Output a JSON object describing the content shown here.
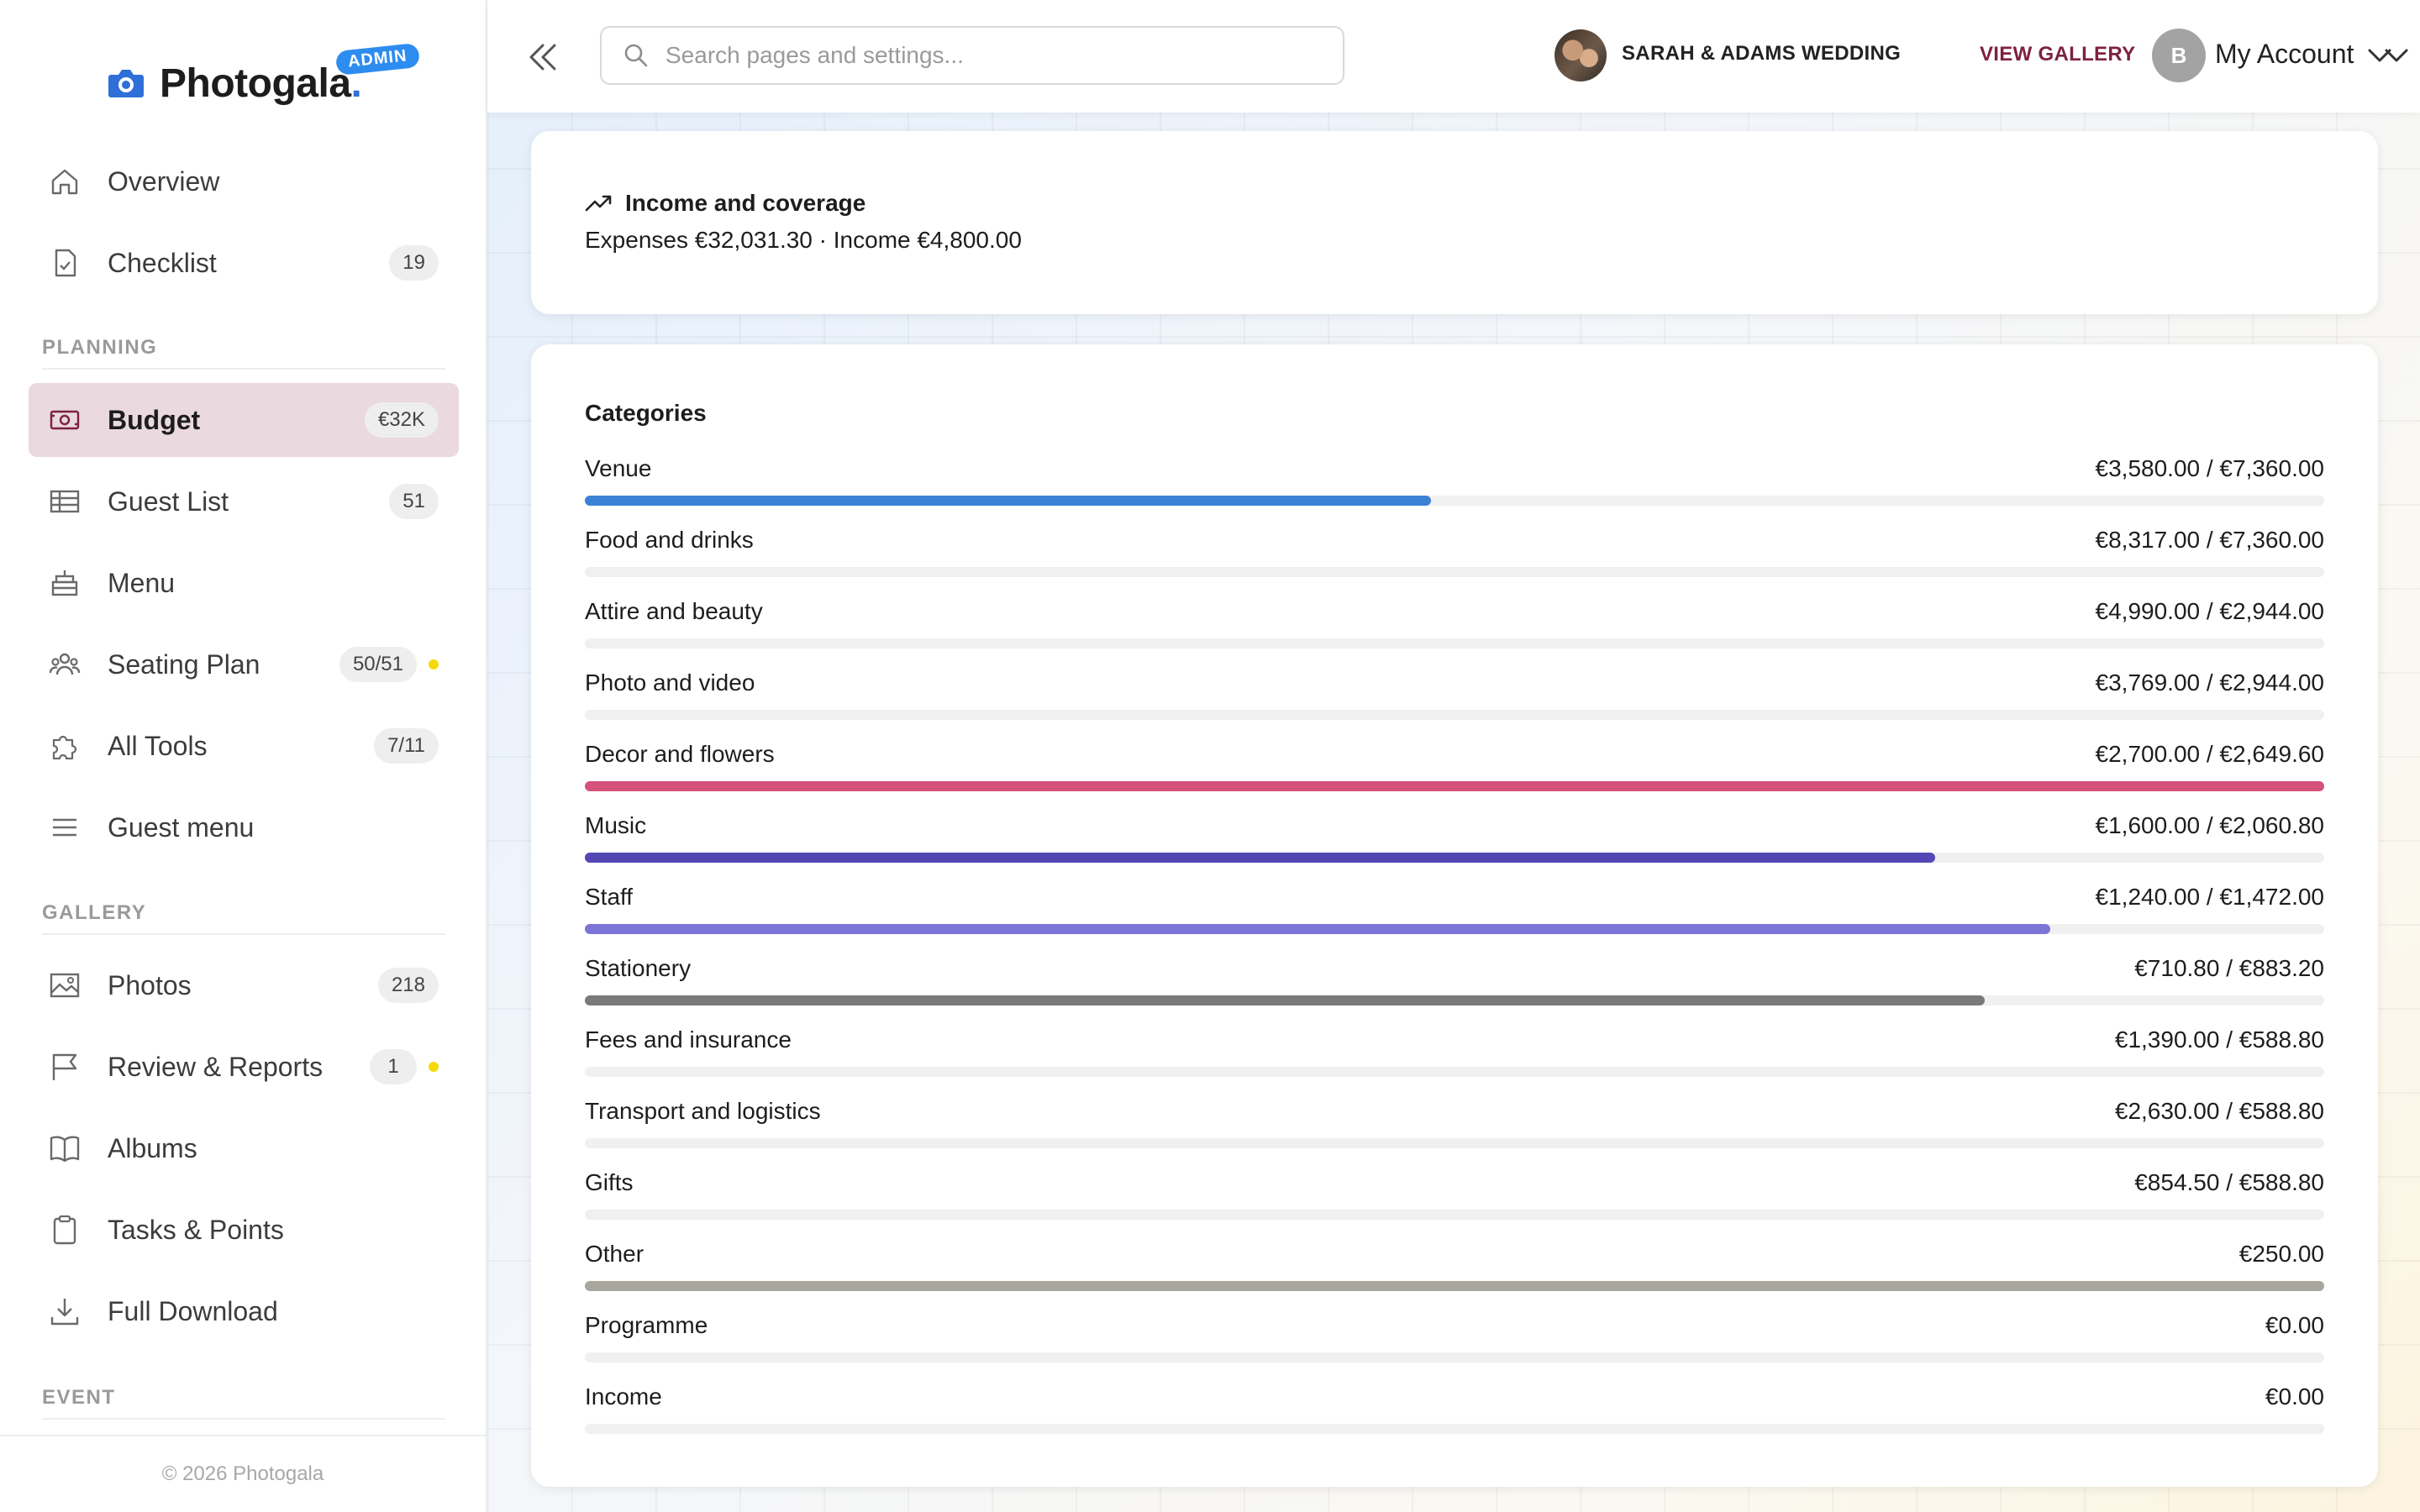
{
  "brand": {
    "name": "Photogala",
    "dot": ".",
    "badge": "ADMIN",
    "brand_color": "#2e6fd8"
  },
  "sidebar": {
    "items": [
      {
        "label": "Overview",
        "icon": "home-icon"
      },
      {
        "label": "Checklist",
        "icon": "checklist-icon",
        "badge": "19"
      },
      {
        "label": "Budget",
        "icon": "money-icon",
        "badge": "€32K",
        "active": true
      },
      {
        "label": "Guest List",
        "icon": "table-icon",
        "badge": "51"
      },
      {
        "label": "Menu",
        "icon": "cake-icon"
      },
      {
        "label": "Seating Plan",
        "icon": "people-icon",
        "badge": "50/51",
        "dot": true
      },
      {
        "label": "All Tools",
        "icon": "puzzle-icon",
        "badge": "7/11"
      },
      {
        "label": "Guest menu",
        "icon": "hamburger-icon"
      },
      {
        "label": "Photos",
        "icon": "image-icon",
        "badge": "218"
      },
      {
        "label": "Review & Reports",
        "icon": "flag-icon",
        "badge": "1",
        "dot": true
      },
      {
        "label": "Albums",
        "icon": "book-icon"
      },
      {
        "label": "Tasks & Points",
        "icon": "clipboard-icon"
      },
      {
        "label": "Full Download",
        "icon": "download-icon"
      }
    ],
    "sections": {
      "planning": "PLANNING",
      "gallery": "GALLERY",
      "event": "EVENT"
    },
    "footer": "© 2026 Photogala"
  },
  "topbar": {
    "search_placeholder": "Search pages and settings...",
    "event_name": "SARAH & ADAMS WEDDING",
    "view_gallery": "VIEW GALLERY",
    "account_initial": "B",
    "account_label": "My Account",
    "accent_color": "#7d2142"
  },
  "income_card": {
    "title": "Income and coverage",
    "summary": "Expenses €32,031.30 · Income €4,800.00"
  },
  "categories_card": {
    "title": "Categories",
    "rows": [
      {
        "name": "Venue",
        "amount": "€3,580.00 / €7,360.00",
        "fill": 0.4864,
        "color": "#3b82d6"
      },
      {
        "name": "Food and drinks",
        "amount": "€8,317.00 / €7,360.00",
        "fill": 0,
        "color": "#cccccc"
      },
      {
        "name": "Attire and beauty",
        "amount": "€4,990.00 / €2,944.00",
        "fill": 0,
        "color": "#cccccc"
      },
      {
        "name": "Photo and video",
        "amount": "€3,769.00 / €2,944.00",
        "fill": 0,
        "color": "#cccccc"
      },
      {
        "name": "Decor and flowers",
        "amount": "€2,700.00 / €2,649.60",
        "fill": 1.0,
        "color": "#d4527a"
      },
      {
        "name": "Music",
        "amount": "€1,600.00 / €2,060.80",
        "fill": 0.7764,
        "color": "#5447b5"
      },
      {
        "name": "Staff",
        "amount": "€1,240.00 / €1,472.00",
        "fill": 0.8424,
        "color": "#7d74d8"
      },
      {
        "name": "Stationery",
        "amount": "€710.80 / €883.20",
        "fill": 0.8048,
        "color": "#7a7a7a"
      },
      {
        "name": "Fees and insurance",
        "amount": "€1,390.00 / €588.80",
        "fill": 0,
        "color": "#cccccc"
      },
      {
        "name": "Transport and logistics",
        "amount": "€2,630.00 / €588.80",
        "fill": 0,
        "color": "#cccccc"
      },
      {
        "name": "Gifts",
        "amount": "€854.50 / €588.80",
        "fill": 0,
        "color": "#cccccc"
      },
      {
        "name": "Other",
        "amount": "€250.00",
        "fill": 1.0,
        "color": "#a9a69e"
      },
      {
        "name": "Programme",
        "amount": "€0.00",
        "fill": 0,
        "color": "#cccccc"
      },
      {
        "name": "Income",
        "amount": "€0.00",
        "fill": 0,
        "color": "#cccccc"
      }
    ]
  }
}
